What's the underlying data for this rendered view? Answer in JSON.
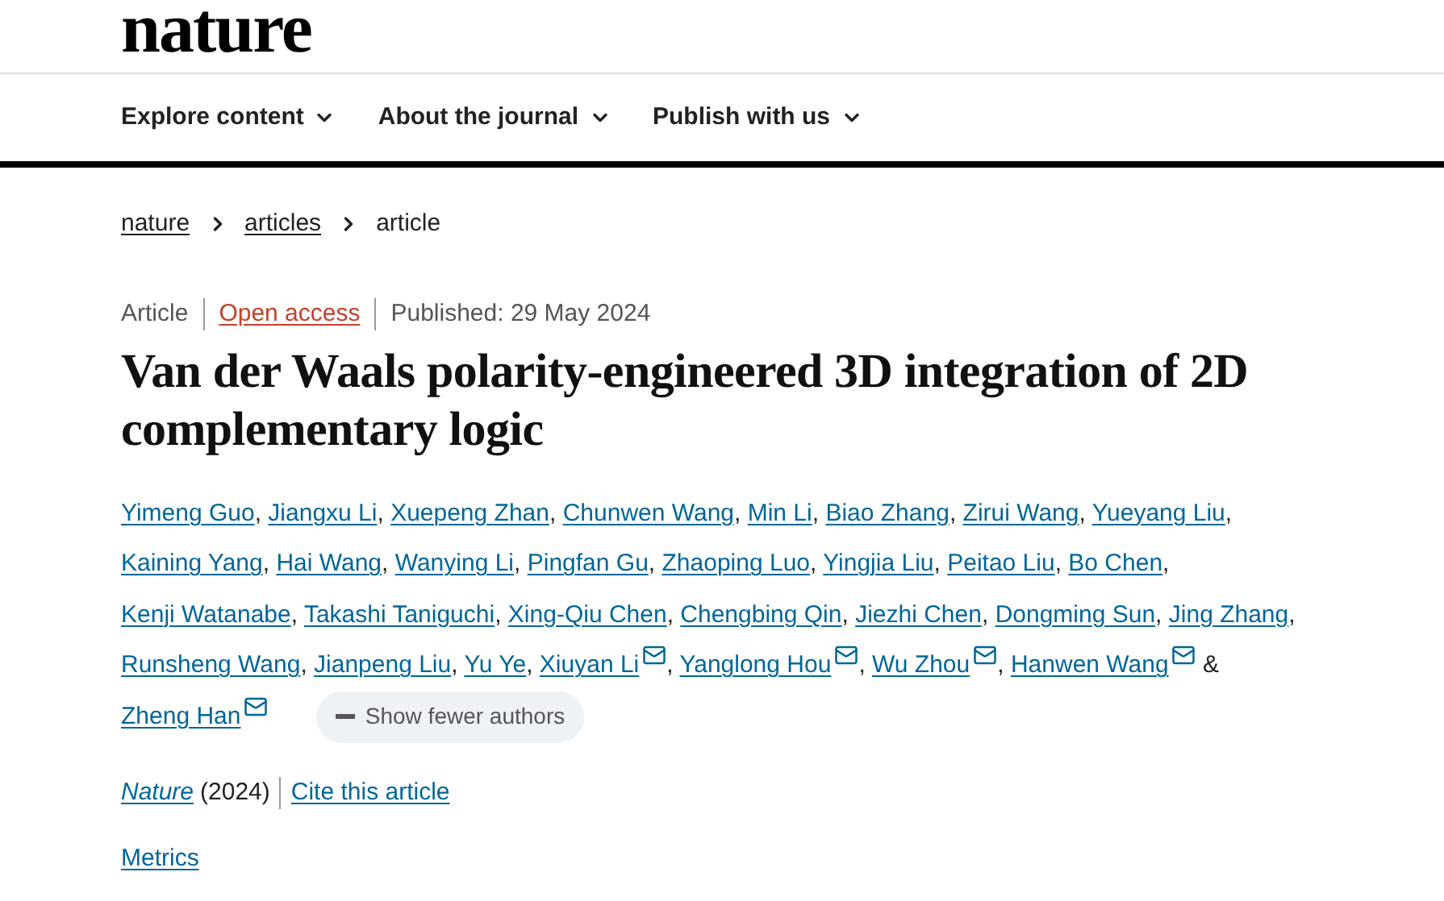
{
  "logo": "nature",
  "nav": [
    {
      "label": "Explore content"
    },
    {
      "label": "About the journal"
    },
    {
      "label": "Publish with us"
    }
  ],
  "breadcrumbs": [
    {
      "label": "nature",
      "link": true
    },
    {
      "label": "articles",
      "link": true
    },
    {
      "label": "article",
      "link": false
    }
  ],
  "meta": [
    {
      "label": "Article",
      "kind": "text"
    },
    {
      "label": "Open access",
      "kind": "access"
    },
    {
      "label": "Published: 29 May 2024",
      "kind": "text"
    }
  ],
  "title": "Van der Waals polarity-engineered 3D integration of 2D complementary logic",
  "authors": [
    {
      "name": "Yimeng Guo",
      "email": false,
      "separator": ","
    },
    {
      "name": "Jiangxu Li",
      "email": false,
      "separator": ","
    },
    {
      "name": "Xuepeng Zhan",
      "email": false,
      "separator": ","
    },
    {
      "name": "Chunwen Wang",
      "email": false,
      "separator": ","
    },
    {
      "name": "Min Li",
      "email": false,
      "separator": ","
    },
    {
      "name": "Biao Zhang",
      "email": false,
      "separator": ","
    },
    {
      "name": "Zirui Wang",
      "email": false,
      "separator": ","
    },
    {
      "name": "Yueyang Liu",
      "email": false,
      "separator": ","
    },
    {
      "name": "Kaining Yang",
      "email": false,
      "separator": ","
    },
    {
      "name": "Hai Wang",
      "email": false,
      "separator": ","
    },
    {
      "name": "Wanying Li",
      "email": false,
      "separator": ","
    },
    {
      "name": "Pingfan Gu",
      "email": false,
      "separator": ","
    },
    {
      "name": "Zhaoping Luo",
      "email": false,
      "separator": ","
    },
    {
      "name": "Yingjia Liu",
      "email": false,
      "separator": ","
    },
    {
      "name": "Peitao Liu",
      "email": false,
      "separator": ","
    },
    {
      "name": "Bo Chen",
      "email": false,
      "separator": ","
    },
    {
      "name": "Kenji Watanabe",
      "email": false,
      "separator": ","
    },
    {
      "name": "Takashi Taniguchi",
      "email": false,
      "separator": ","
    },
    {
      "name": "Xing-Qiu Chen",
      "email": false,
      "separator": ","
    },
    {
      "name": "Chengbing Qin",
      "email": false,
      "separator": ","
    },
    {
      "name": "Jiezhi Chen",
      "email": false,
      "separator": ","
    },
    {
      "name": "Dongming Sun",
      "email": false,
      "separator": ","
    },
    {
      "name": "Jing Zhang",
      "email": false,
      "separator": ","
    },
    {
      "name": "Runsheng Wang",
      "email": false,
      "separator": ","
    },
    {
      "name": "Jianpeng Liu",
      "email": false,
      "separator": ","
    },
    {
      "name": "Yu Ye",
      "email": false,
      "separator": ","
    },
    {
      "name": "Xiuyan Li",
      "email": true,
      "separator": ","
    },
    {
      "name": "Yanglong Hou",
      "email": true,
      "separator": ","
    },
    {
      "name": "Wu Zhou",
      "email": true,
      "separator": ","
    },
    {
      "name": "Hanwen Wang",
      "email": true,
      "separator": "&"
    },
    {
      "name": "Zheng Han",
      "email": true
    }
  ],
  "authors_toggle": {
    "label": "Show fewer authors"
  },
  "citation": {
    "journal": "Nature",
    "year": "(2024)",
    "cite": "Cite this article"
  },
  "metrics": "Metrics"
}
